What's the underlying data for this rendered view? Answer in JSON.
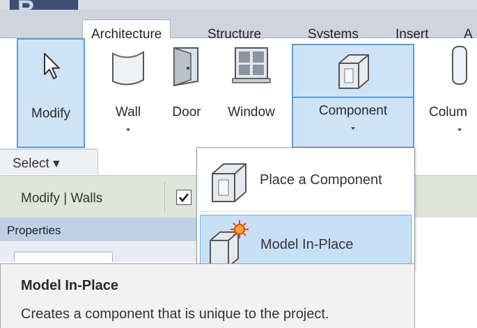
{
  "app": {
    "logo_letter": "R"
  },
  "tabs": [
    {
      "label": "Architecture",
      "active": true
    },
    {
      "label": "Structure"
    },
    {
      "label": "Systems"
    },
    {
      "label": "Insert"
    },
    {
      "label": "A"
    }
  ],
  "ribbon": {
    "buttons": [
      {
        "label": "Modify",
        "icon": "cursor-arrow-icon",
        "selected": true
      },
      {
        "label": "Wall",
        "icon": "wall-icon",
        "has_dropdown": true
      },
      {
        "label": "Door",
        "icon": "door-icon"
      },
      {
        "label": "Window",
        "icon": "window-icon"
      },
      {
        "label": "Component",
        "icon": "component-icon",
        "selected": true,
        "has_dropdown": true
      },
      {
        "label": "Colum",
        "icon": "column-icon",
        "has_dropdown": true
      }
    ],
    "select_panel": "Select ▾"
  },
  "options_bar": {
    "context_label": "Modify | Walls",
    "checkbox_checked": true
  },
  "properties": {
    "title": "Properties"
  },
  "component_menu": {
    "items": [
      {
        "label": "Place a Component",
        "icon": "place-component-icon"
      },
      {
        "label": "Model In-Place",
        "icon": "model-in-place-icon",
        "highlighted": true
      }
    ]
  },
  "tooltip": {
    "title": "Model In-Place",
    "description": "Creates a component that is unique to the project."
  },
  "colors": {
    "selection_fill": "#cfe3f6",
    "selection_border": "#5b9bd5",
    "options_bar": "#dfe6d9",
    "properties_header": "#bed1e6"
  }
}
